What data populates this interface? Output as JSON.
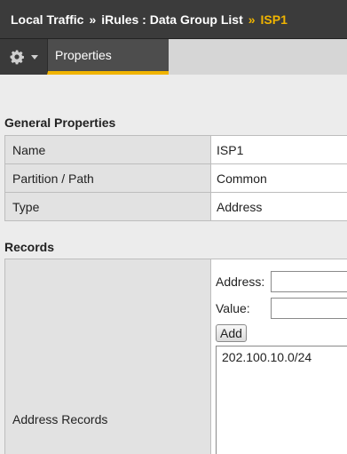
{
  "breadcrumb": {
    "root": "Local Traffic",
    "separator": "»",
    "section": "iRules : Data Group List",
    "current": "ISP1"
  },
  "tabs": {
    "properties_label": "Properties"
  },
  "general": {
    "title": "General Properties",
    "rows": [
      {
        "label": "Name",
        "value": "ISP1"
      },
      {
        "label": "Partition / Path",
        "value": "Common"
      },
      {
        "label": "Type",
        "value": "Address"
      }
    ]
  },
  "records": {
    "title": "Records",
    "row_label": "Address Records",
    "address_label": "Address:",
    "address_value": "",
    "value_label": "Value:",
    "value_value": "",
    "add_label": "Add",
    "items": [
      "202.100.10.0/24"
    ]
  },
  "colors": {
    "accent": "#f0b400",
    "header_bg": "#3b3b3b"
  },
  "icons": {
    "menu": "gear-icon"
  }
}
